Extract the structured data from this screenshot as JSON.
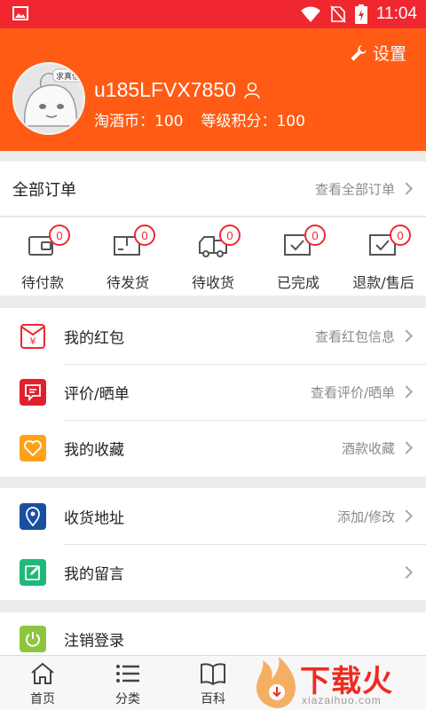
{
  "status_bar": {
    "time": "11:04",
    "icons": [
      "image-icon",
      "wifi-icon",
      "no-sim-icon",
      "battery-charging-icon"
    ],
    "color": "#f0272f"
  },
  "header": {
    "bg_color": "#ff5b14",
    "settings_label": "设置",
    "avatar_badge": "求真信",
    "username": "u185LFVX7850",
    "coins": "淘酒币：100",
    "level_points": "等级积分：100"
  },
  "orders": {
    "title": "全部订单",
    "link": "查看全部订单",
    "items": [
      {
        "label": "待付款",
        "count": "0",
        "icon": "wallet-icon"
      },
      {
        "label": "待发货",
        "count": "0",
        "icon": "package-icon"
      },
      {
        "label": "待收货",
        "count": "0",
        "icon": "delivery-truck-icon"
      },
      {
        "label": "已完成",
        "count": "0",
        "icon": "check-box-icon"
      },
      {
        "label": "退款/售后",
        "count": "0",
        "icon": "refund-check-icon"
      }
    ]
  },
  "menu": {
    "red_packet": {
      "label": "我的红包",
      "link": "查看红包信息",
      "icon": "red-packet-icon",
      "color": "#f0272f"
    },
    "review": {
      "label": "评价/晒单",
      "link": "查看评价/晒单",
      "icon": "chat-bubble-icon",
      "color": "#e0202a"
    },
    "favorites": {
      "label": "我的收藏",
      "link": "酒款收藏",
      "icon": "heart-icon",
      "color": "#ffa21a"
    },
    "address": {
      "label": "收货地址",
      "link": "添加/修改",
      "icon": "location-pin-icon",
      "color": "#1a4fa0"
    },
    "messages": {
      "label": "我的留言",
      "link": "",
      "icon": "edit-icon",
      "color": "#1fb97a"
    },
    "logout": {
      "label": "注销登录",
      "icon": "power-icon",
      "color": "#8cc63f"
    }
  },
  "tabs": [
    {
      "label": "首页",
      "icon": "home-icon"
    },
    {
      "label": "分类",
      "icon": "list-icon"
    },
    {
      "label": "百科",
      "icon": "book-icon"
    }
  ],
  "watermark": {
    "text": "下载火",
    "url": "xiazaihuo.com"
  }
}
